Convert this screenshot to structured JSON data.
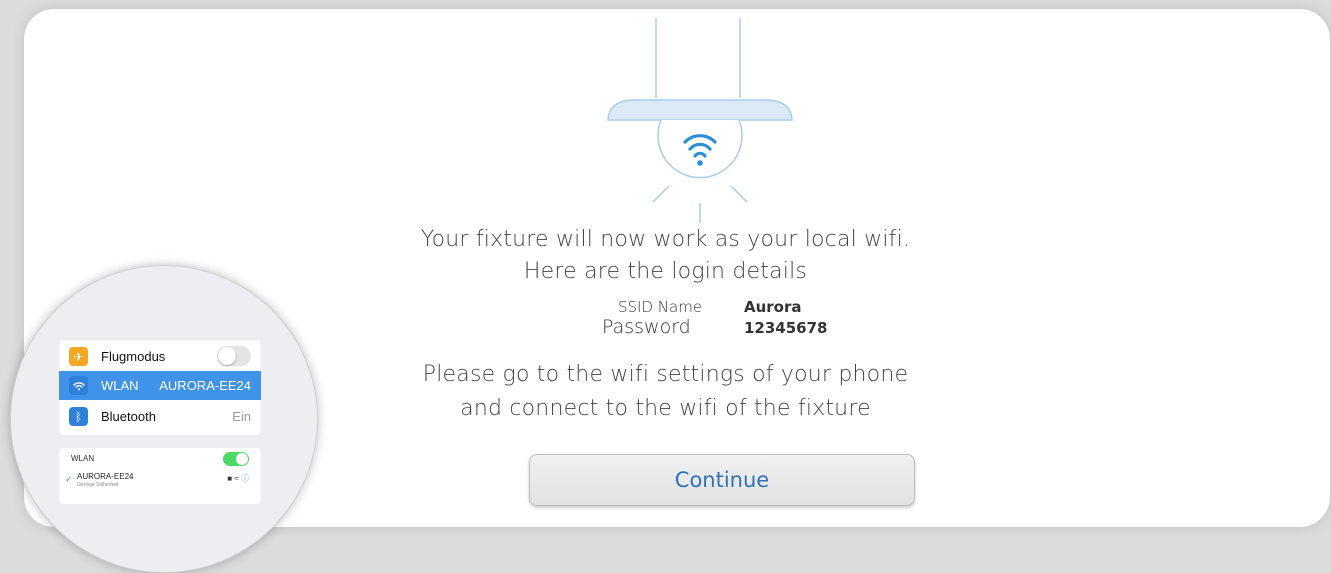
{
  "headline": {
    "line1": "Your fixture will now work as your local wifi.",
    "line2": "Here are the login details"
  },
  "credentials": {
    "ssid_label": "SSID Name",
    "ssid_value": "Aurora",
    "password_label": "Password",
    "password_value": "12345678"
  },
  "instructions": {
    "line1": "Please go to the wifi settings of your phone",
    "line2": "and connect to the wifi of the fixture"
  },
  "continue_label": "Continue",
  "icons": [
    "lamp-illustration",
    "wifi-icon",
    "airplane-icon",
    "wifi-icon",
    "bluetooth-icon",
    "checkmark-icon",
    "lock-icon",
    "info-icon"
  ],
  "colors": {
    "accent": "#2d73b6",
    "lamp_line": "#a9cdea",
    "wlan_row": "#3f93e8",
    "toggle_on": "#4cd964"
  },
  "phone": {
    "rows": [
      {
        "label": "Flugmodus",
        "value": ""
      },
      {
        "label": "WLAN",
        "value": "AURORA-EE24"
      },
      {
        "label": "Bluetooth",
        "value": "Ein"
      }
    ],
    "wlan_panel": {
      "title": "WLAN",
      "network": "AURORA-EE24",
      "security": "Geringe Sicherheit"
    }
  }
}
